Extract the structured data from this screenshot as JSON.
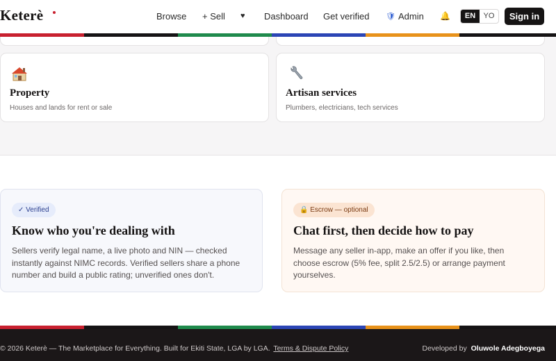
{
  "brand": {
    "name": "Keterè"
  },
  "nav": {
    "browse": "Browse",
    "sell": "+ Sell",
    "favorites_glyph": "♥",
    "dashboard": "Dashboard",
    "get_verified": "Get verified",
    "admin": "Admin",
    "notifications_glyph": "🔔",
    "admin_glyph": "🛡"
  },
  "language": {
    "options": [
      "EN",
      "YO"
    ],
    "selected": "EN"
  },
  "auth": {
    "sign_in": "Sign in"
  },
  "stripe_colors": [
    "#c8202f",
    "#151314",
    "#1f8a4c",
    "#2b45b5",
    "#e8921a",
    "#151314"
  ],
  "categories": [
    {
      "icon": "🏠",
      "icon_name": "house-icon",
      "title": "Property",
      "description": "Houses and lands for rent or sale"
    },
    {
      "icon": "🔧",
      "icon_name": "wrench-icon",
      "title": "Artisan services",
      "description": "Plumbers, electricians, tech services"
    }
  ],
  "features": [
    {
      "badge": "✓ Verified",
      "title": "Know who you're dealing with",
      "body": "Sellers verify legal name, a live photo and NIN — checked instantly against NIMC records. Verified sellers share a phone number and build a public rating; unverified ones don't."
    },
    {
      "badge": "🔒 Escrow — optional",
      "title": "Chat first, then decide how to pay",
      "body": "Message any seller in-app, make an offer if you like, then choose escrow (5% fee, split 2.5/2.5) or arrange payment yourselves."
    }
  ],
  "footer": {
    "text": "© 2026 Keterè — The Marketplace for Everything. Built for Ekiti State, LGA by LGA.",
    "link": "Terms & Dispute Policy",
    "credit_prefix": "Developed by",
    "credit_name": "Oluwole Adegboyega"
  }
}
